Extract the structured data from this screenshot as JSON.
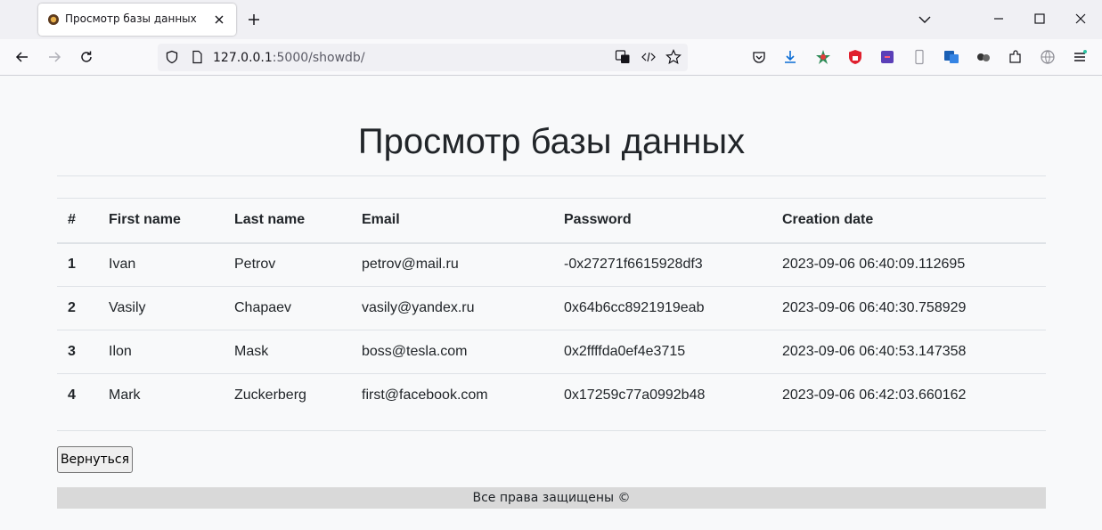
{
  "browser": {
    "tab_title": "Просмотр базы данных",
    "url_host": "127.0.0.1",
    "url_rest": ":5000/showdb/"
  },
  "page": {
    "title": "Просмотр базы данных",
    "back_button": "Вернуться",
    "footer": "Все права защищены ©"
  },
  "table": {
    "headers": [
      "#",
      "First name",
      "Last name",
      "Email",
      "Password",
      "Creation date"
    ],
    "rows": [
      [
        "1",
        "Ivan",
        "Petrov",
        "petrov@mail.ru",
        "-0x27271f6615928df3",
        "2023-09-06 06:40:09.112695"
      ],
      [
        "2",
        "Vasily",
        "Chapaev",
        "vasily@yandex.ru",
        "0x64b6cc8921919eab",
        "2023-09-06 06:40:30.758929"
      ],
      [
        "3",
        "Ilon",
        "Mask",
        "boss@tesla.com",
        "0x2ffffda0ef4e3715",
        "2023-09-06 06:40:53.147358"
      ],
      [
        "4",
        "Mark",
        "Zuckerberg",
        "first@facebook.com",
        "0x17259c77a0992b48",
        "2023-09-06 06:42:03.660162"
      ]
    ]
  }
}
